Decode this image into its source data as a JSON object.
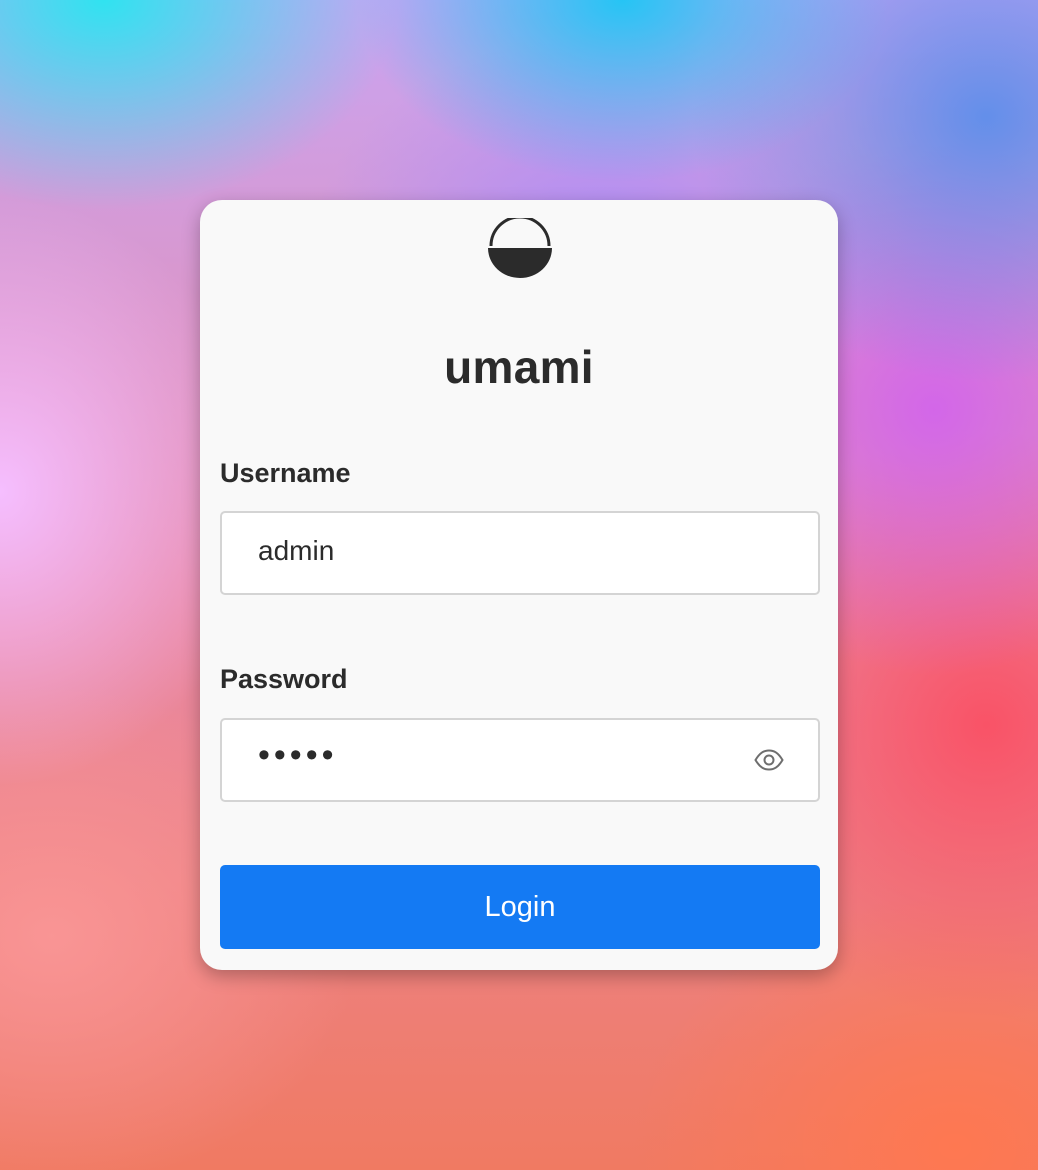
{
  "app": {
    "name": "umami"
  },
  "login_form": {
    "username_label": "Username",
    "username_value": "admin",
    "password_label": "Password",
    "password_masked": "•••••",
    "login_button": "Login"
  },
  "icons": {
    "logo": "umami-logo-icon",
    "password_toggle": "eye-icon"
  },
  "colors": {
    "primary_button": "#147af3",
    "card_background": "#f9f9f9",
    "text": "#2b2b2b"
  }
}
